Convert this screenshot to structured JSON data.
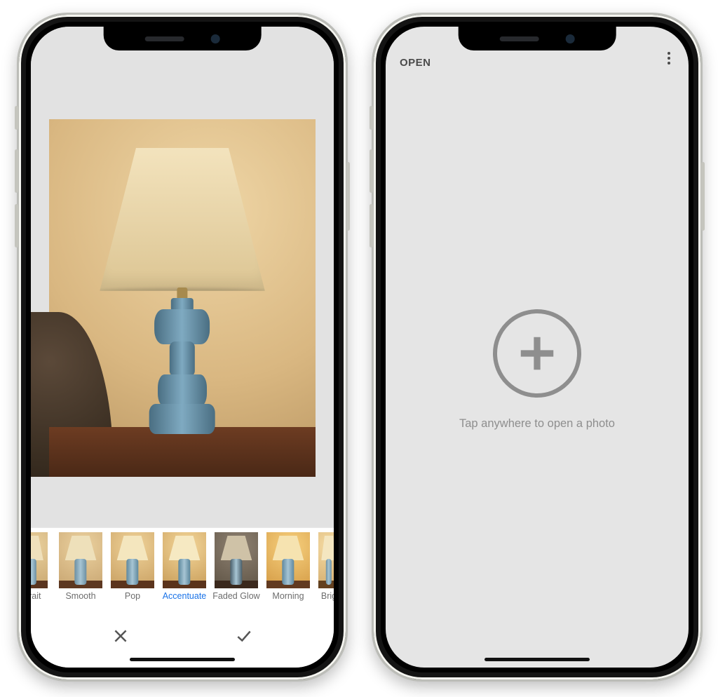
{
  "left": {
    "selected_filter": "Accentuate",
    "filters": [
      {
        "label": "rtrait",
        "cut": "left",
        "bg": "radial-gradient(circle at 55% 25%, #e9d09d, #c8a66f)",
        "shade": "#efe0bb",
        "body": "#6a8ea1",
        "table": "#5a351f"
      },
      {
        "label": "Smooth",
        "cut": "none",
        "bg": "radial-gradient(circle at 55% 25%, #ecd2a0, #c7a470)",
        "shade": "#eee0ba",
        "body": "#6c8fa2",
        "table": "#5d3821"
      },
      {
        "label": "Pop",
        "cut": "none",
        "bg": "radial-gradient(circle at 55% 25%, #f0d39a, #c79e60)",
        "shade": "#f4e6be",
        "body": "#5f889d",
        "table": "#5b341d"
      },
      {
        "label": "Accentuate",
        "cut": "none",
        "bg": "radial-gradient(circle at 55% 25%, #f4d79b, #c69a56)",
        "shade": "#f6e9c2",
        "body": "#5a869c",
        "table": "#5a331b",
        "selected": true
      },
      {
        "label": "Faded Glow",
        "cut": "none",
        "bg": "radial-gradient(circle at 55% 25%, #8f8273, #5e5344)",
        "shade": "#cfc2a7",
        "body": "#495e6a",
        "table": "#3a281c"
      },
      {
        "label": "Morning",
        "cut": "none",
        "bg": "radial-gradient(circle at 55% 25%, #f7d07e, #d39a44)",
        "shade": "#f6e3b0",
        "body": "#5e88a0",
        "table": "#623a20"
      },
      {
        "label": "Brig",
        "cut": "right",
        "bg": "radial-gradient(circle at 55% 25%, #f5dba3, #d4ad6f)",
        "shade": "#f4e6c0",
        "body": "#6b8fa3",
        "table": "#63401f"
      }
    ],
    "actions": {
      "cancel": "Cancel",
      "apply": "Apply"
    }
  },
  "right": {
    "open_label": "OPEN",
    "empty_prompt": "Tap anywhere to open a photo"
  }
}
